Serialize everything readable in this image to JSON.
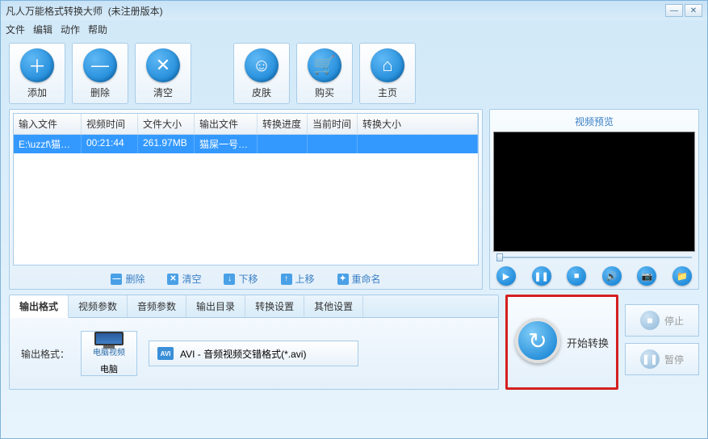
{
  "title": "凡人万能格式转换大师",
  "title_suffix": "(未注册版本)",
  "menu": {
    "file": "文件",
    "edit": "编辑",
    "action": "动作",
    "help": "帮助"
  },
  "toolbar": {
    "add": "添加",
    "del": "删除",
    "clear": "清空",
    "skin": "皮肤",
    "buy": "购买",
    "home": "主页"
  },
  "table": {
    "headers": {
      "input": "输入文件",
      "vtime": "视频时间",
      "fsize": "文件大小",
      "output": "输出文件",
      "progress": "转换进度",
      "ctime": "当前时间",
      "osize": "转换大小"
    },
    "rows": [
      {
        "input": "E:\\uzzf\\猫屎...",
        "vtime": "00:21:44",
        "fsize": "261.97MB",
        "output": "猫屎一号B...",
        "progress": "",
        "ctime": "",
        "osize": ""
      }
    ]
  },
  "list_actions": {
    "del": "删除",
    "clear": "清空",
    "down": "下移",
    "up": "上移",
    "rename": "重命名"
  },
  "preview": {
    "title": "视频预览"
  },
  "tabs": {
    "fmt": "输出格式",
    "vparam": "视频参数",
    "aparam": "音频参数",
    "outdir": "输出目录",
    "conv": "转换设置",
    "other": "其他设置"
  },
  "fmt": {
    "label": "输出格式：",
    "device_top": "电脑视频",
    "device_bottom": "电脑",
    "codec": "AVI - 音频视频交错格式(*.avi)"
  },
  "start": {
    "label": "开始转换"
  },
  "side": {
    "stop": "停止",
    "pause": "暂停"
  }
}
